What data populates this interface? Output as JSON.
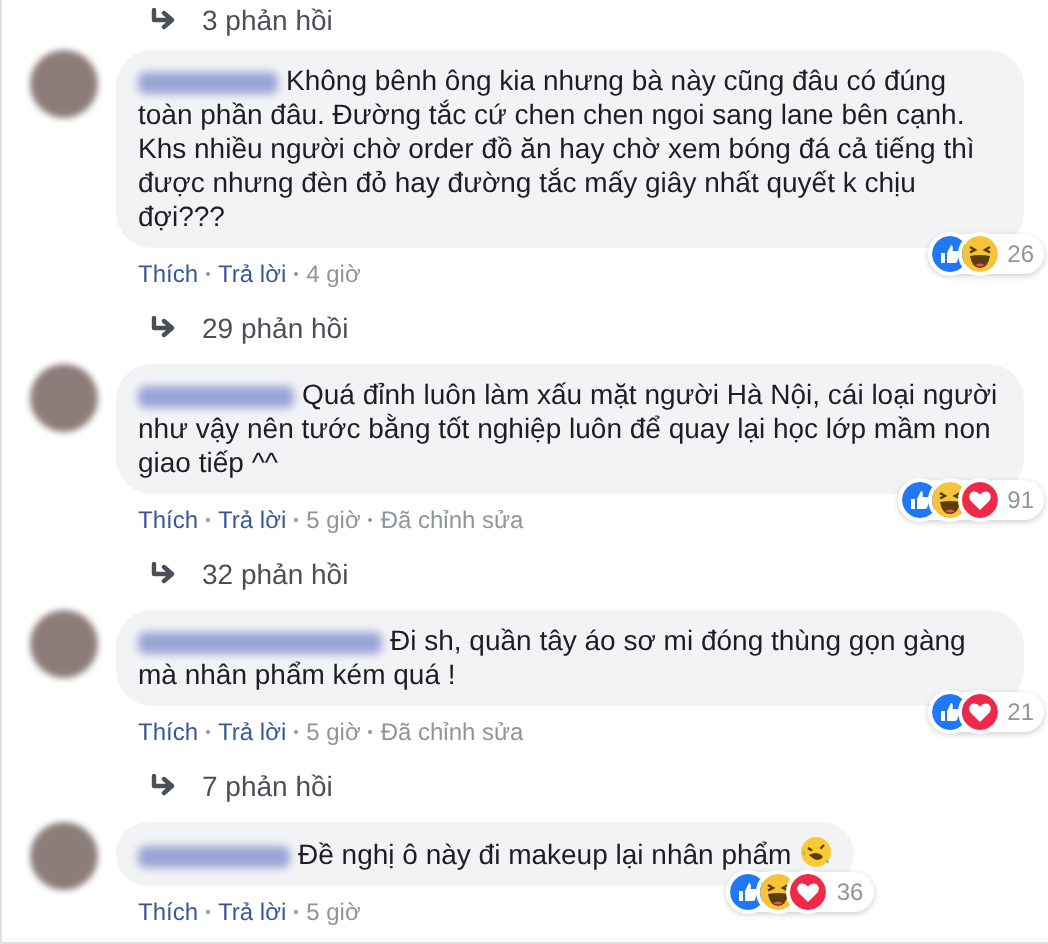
{
  "top_replies": "3 phản hồi",
  "comments": [
    {
      "text": "Không bênh ông kia nhưng bà này cũng đâu có đúng toàn phần đâu. Đường tắc cứ chen chen ngoi sang lane bên cạnh. Khs nhiều người chờ order đồ ăn hay chờ xem bóng đá cả tiếng thì được nhưng đèn đỏ hay đường tắc mấy giây nhất quyết k chịu đợi???",
      "reactions": [
        {
          "kind": "like"
        },
        {
          "kind": "haha"
        }
      ],
      "reaction_count": "26",
      "actions": [
        "Thích",
        "Trả lời",
        "4 giờ"
      ],
      "replies": "29 phản hồi"
    },
    {
      "text": "Quá đỉnh luôn làm xấu mặt người Hà Nội, cái loại người như vậy nên tước bằng tốt nghiệp luôn để quay lại học lớp mầm non giao tiếp ^^",
      "reactions": [
        {
          "kind": "like"
        },
        {
          "kind": "haha"
        },
        {
          "kind": "love"
        }
      ],
      "reaction_count": "91",
      "actions": [
        "Thích",
        "Trả lời",
        "5 giờ",
        "Đã chỉnh sửa"
      ],
      "replies": "32 phản hồi"
    },
    {
      "text": "Đi sh, quần tây áo sơ mi đóng thùng gọn gàng mà nhân phẩm kém quá !",
      "reactions": [
        {
          "kind": "like"
        },
        {
          "kind": "love"
        }
      ],
      "reaction_count": "21",
      "actions": [
        "Thích",
        "Trả lời",
        "5 giờ",
        "Đã chỉnh sửa"
      ],
      "replies": "7 phản hồi"
    },
    {
      "text": "Đề nghị ô này đi makeup lại nhân phẩm",
      "emoji": {
        "kind": "rofl"
      },
      "reactions": [
        {
          "kind": "like"
        },
        {
          "kind": "haha"
        },
        {
          "kind": "love"
        }
      ],
      "reaction_count": "36",
      "actions": [
        "Thích",
        "Trả lời",
        "5 giờ"
      ]
    }
  ]
}
